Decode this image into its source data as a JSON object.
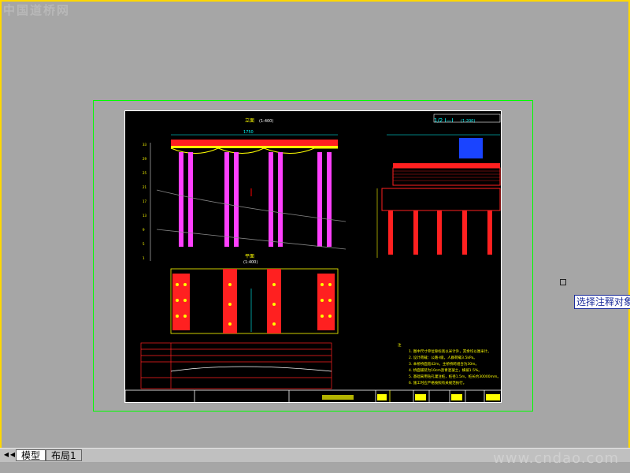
{
  "watermark_top": "中国道桥网",
  "watermark_bottom": "www.cndao.com",
  "drawing": {
    "elevation_title": "立面",
    "elevation_scale": "(1:400)",
    "plan_title": "平面",
    "plan_scale": "(1:400)",
    "section_title": "1/2 I—I",
    "section_scale": "(1:200)",
    "dim_1750": "1750",
    "note_heading": "注",
    "notes": [
      "1. 图中尺寸单位除标高以米计外，其余均以厘米计。",
      "2. 设计荷载：公路-I级，人群荷载3.5kPa。",
      "3. 本桥桥面宽42m，主桥桥跨组合为30m。",
      "4. 桥面铺装为10cm沥青混凝土，横坡1.5%。",
      "5. 基础采用钻孔灌注桩，桩径1.5m，桩长约30000mm。",
      "6. 施工时应严格按照有关规范执行。"
    ]
  },
  "tooltip": "选择注释对象",
  "tabs": [
    {
      "label": "模型"
    },
    {
      "label": "布局1"
    }
  ]
}
